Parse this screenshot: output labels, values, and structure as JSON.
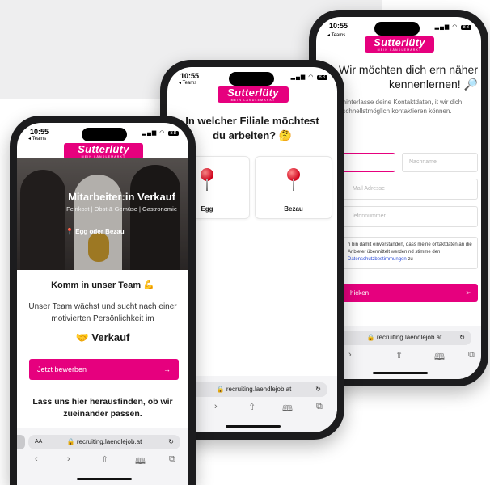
{
  "colors": {
    "brand_pink": "#e6007e",
    "phone_frame": "#1c1c1e"
  },
  "brand": {
    "logo_text": "Sutterlüty",
    "logo_sub": "MEIN LÄNDLEMARKT"
  },
  "browser": {
    "url": "recruiting.laendlejob.at",
    "text_size": "AA"
  },
  "phone_front": {
    "time": "10:55",
    "back_label": "◂ Teams",
    "hero_title": "Mitarbeiter:in Verkauf",
    "hero_subtitle": "Feinkost | Obst & Gemüse | Gastronomie",
    "hero_location": "📍 Egg oder Bezau",
    "section_heading": "Komm in unser Team 💪",
    "section_text": "Unser Team wächst und sucht nach einer motivierten Persönlichkeit im",
    "role": "🤝 Verkauf",
    "apply_button": "Jetzt bewerben",
    "apply_arrow": "→",
    "bottom_heading": "Lass uns hier herausfinden, ob wir zueinander passen."
  },
  "phone_middle": {
    "time": "10:55",
    "back_label": "◂ Teams",
    "question": "In welcher Filiale möchtest du arbeiten? 🤔",
    "options": [
      {
        "label": "Egg"
      },
      {
        "label": "Bezau"
      }
    ]
  },
  "phone_back": {
    "time": "10:55",
    "back_label": "◂ Teams",
    "title": "Wir möchten dich ern näher kennenlernen! 🔎",
    "intro": "itte hinterlasse deine Kontaktdaten, it wir dich schnellstmöglich kontaktieren können.",
    "first_name_placeholder": "me",
    "last_name_placeholder": "Nachname",
    "email_placeholder": "Mail Adresse",
    "phone_placeholder": "lefonnummer",
    "consent_text": "h bin damit einverstanden, dass meine ontaktdaten an die Anbieter übermittelt werden nd stimme den",
    "consent_link": "Datenschutzbestimmungen",
    "consent_suffix": " zu",
    "submit_label": "hicken"
  }
}
